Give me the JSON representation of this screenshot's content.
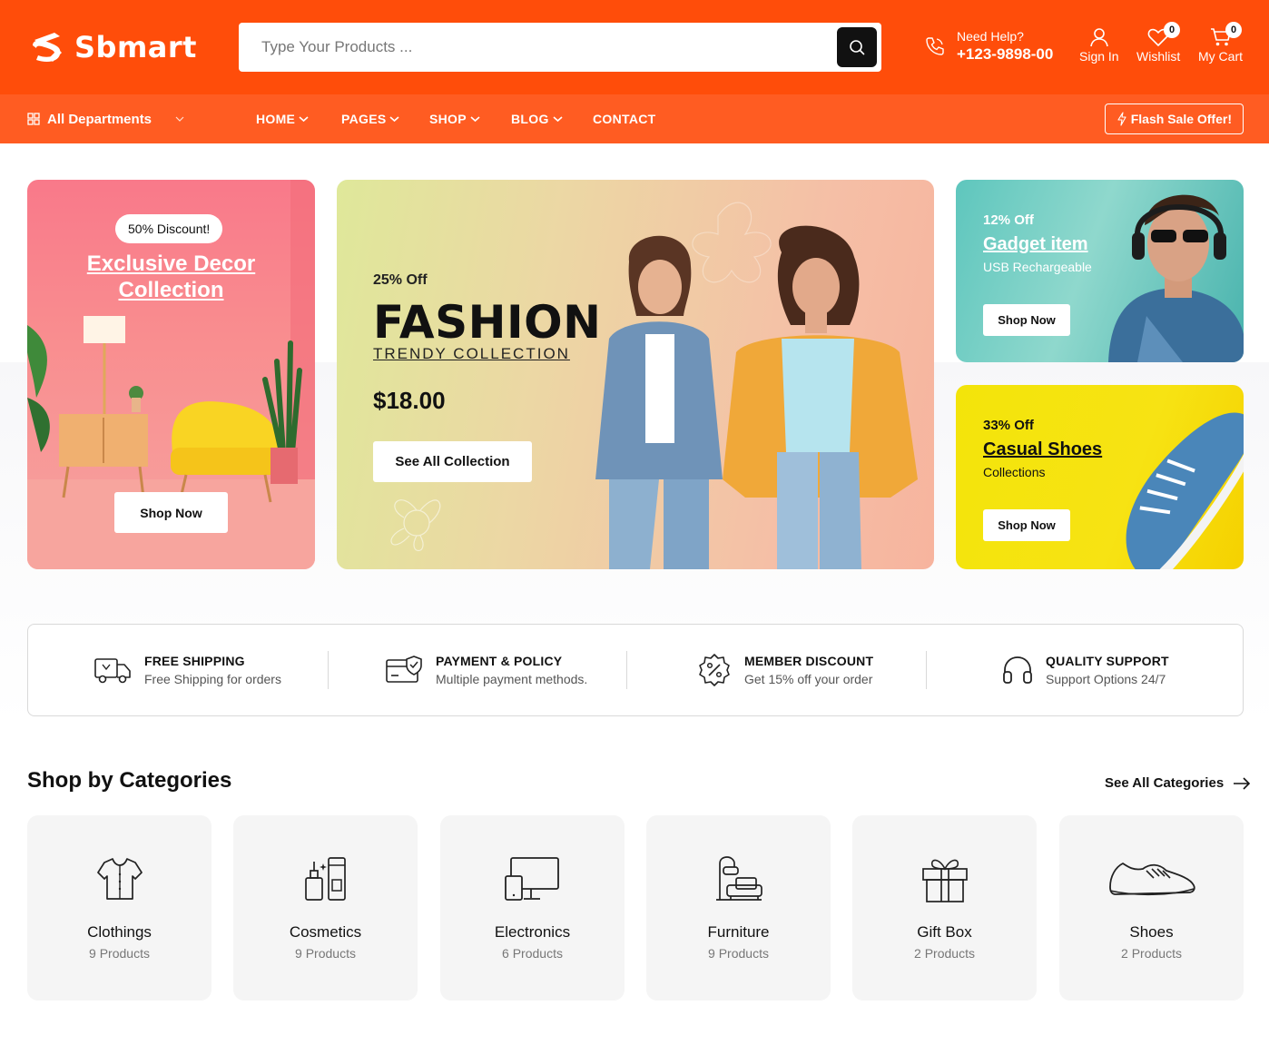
{
  "brand": {
    "name": "Sbmart",
    "color": "#ff4d0a"
  },
  "search": {
    "placeholder": "Type Your Products ..."
  },
  "help": {
    "label": "Need Help?",
    "phone": "+123-9898-00"
  },
  "header_actions": {
    "sign_in": "Sign In",
    "wishlist": "Wishlist",
    "wishlist_count": "0",
    "cart": "My Cart",
    "cart_count": "0"
  },
  "nav": {
    "departments": "All Departments",
    "items": [
      "HOME",
      "PAGES",
      "SHOP",
      "BLOG",
      "CONTACT"
    ],
    "flash": "Flash Sale Offer!"
  },
  "hero": {
    "left": {
      "badge": "50% Discount!",
      "title_line1": "Exclusive Decor",
      "title_line2": "Collection",
      "cta": "Shop Now"
    },
    "main": {
      "off": "25% Off",
      "title": "FASHION",
      "subtitle": "TRENDY COLLECTION",
      "price": "$18.00",
      "cta": "See All Collection"
    },
    "right_top": {
      "off": "12% Off",
      "title": "Gadget item",
      "subtitle": "USB Rechargeable",
      "cta": "Shop Now"
    },
    "right_bottom": {
      "off": "33% Off",
      "title": "Casual Shoes",
      "subtitle": "Collections",
      "cta": "Shop Now"
    }
  },
  "features": [
    {
      "icon": "truck-icon",
      "title": "FREE SHIPPING",
      "text": "Free Shipping for orders"
    },
    {
      "icon": "card-shield-icon",
      "title": "PAYMENT & POLICY",
      "text": "Multiple payment methods."
    },
    {
      "icon": "discount-badge-icon",
      "title": "MEMBER DISCOUNT",
      "text": "Get 15% off your order"
    },
    {
      "icon": "headphones-icon",
      "title": "QUALITY SUPPORT",
      "text": "Support Options 24/7"
    }
  ],
  "categories": {
    "title": "Shop by Categories",
    "see_all": "See All Categories",
    "items": [
      {
        "name": "Clothings",
        "count": "9 Products",
        "icon": "shirt-icon"
      },
      {
        "name": "Cosmetics",
        "count": "9 Products",
        "icon": "cosmetics-icon"
      },
      {
        "name": "Electronics",
        "count": "6 Products",
        "icon": "devices-icon"
      },
      {
        "name": "Furniture",
        "count": "9 Products",
        "icon": "furniture-icon"
      },
      {
        "name": "Gift Box",
        "count": "2 Products",
        "icon": "gift-icon"
      },
      {
        "name": "Shoes",
        "count": "2 Products",
        "icon": "shoe-icon"
      }
    ]
  }
}
